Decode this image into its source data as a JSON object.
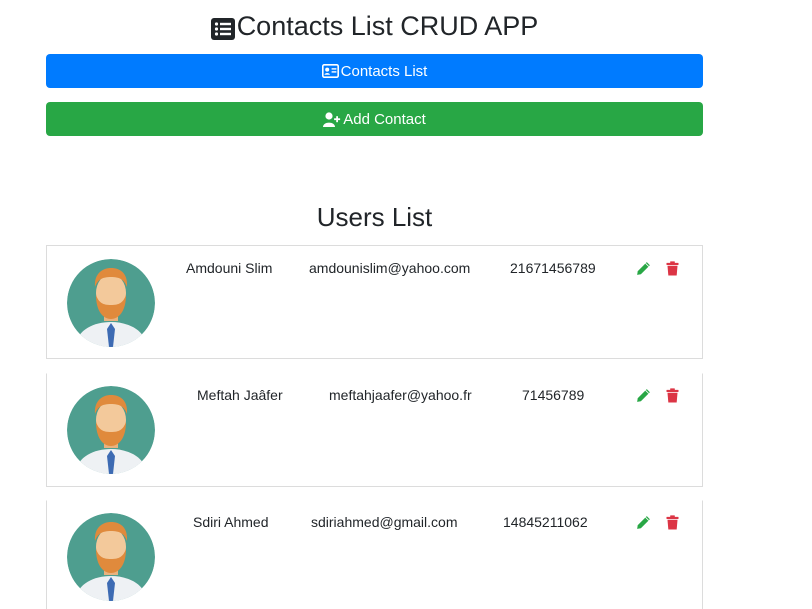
{
  "app": {
    "title": "Contacts List CRUD APP",
    "title_icon": "list-alt-icon"
  },
  "nav": {
    "contacts_list_label": "Contacts List",
    "contacts_list_icon": "address-card-icon",
    "add_contact_label": "Add Contact",
    "add_contact_icon": "user-plus-icon"
  },
  "colors": {
    "primary": "#007bff",
    "success": "#28a745",
    "danger": "#dc3545",
    "text": "#212529",
    "avatar_bg": "#4e9e8f"
  },
  "users": {
    "heading": "Users List",
    "items": [
      {
        "name": "Amdouni Slim",
        "email": "amdounislim@yahoo.com",
        "phone": "21671456789"
      },
      {
        "name": "Meftah Jaâfer",
        "email": "meftahjaafer@yahoo.fr",
        "phone": "71456789"
      },
      {
        "name": "Sdiri Ahmed",
        "email": "sdiriahmed@gmail.com",
        "phone": "14845211062"
      }
    ],
    "edit_icon": "pencil-icon",
    "delete_icon": "trash-icon"
  }
}
